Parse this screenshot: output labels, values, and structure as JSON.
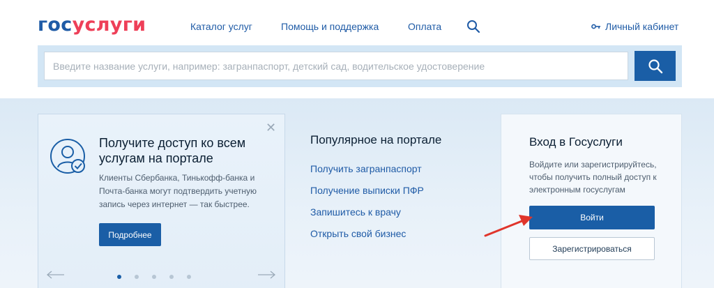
{
  "header": {
    "logo_part1": "гос",
    "logo_part2": "услуги",
    "nav": [
      {
        "label": "Каталог услуг"
      },
      {
        "label": "Помощь и поддержка"
      },
      {
        "label": "Оплата"
      }
    ],
    "cabinet_label": "Личный кабинет"
  },
  "search": {
    "placeholder": "Введите название услуги, например: загранпаспорт, детский сад, водительское удостоверение"
  },
  "promo": {
    "title": "Получите доступ ко всем услугам на портале",
    "text": "Клиенты Сбербанка, Тинькофф-банка и Почта-банка могут подтвердить учетную запись через интернет — так быстрее.",
    "button_label": "Подробнее",
    "close_glyph": "✕",
    "slides_count": 5,
    "active_slide": 1
  },
  "popular": {
    "title": "Популярное на портале",
    "links": [
      {
        "label": "Получить загранпаспорт"
      },
      {
        "label": "Получение выписки ПФР"
      },
      {
        "label": "Запишитесь к врачу"
      },
      {
        "label": "Открыть свой бизнес"
      }
    ]
  },
  "login": {
    "title": "Вход в Госуслуги",
    "text": "Войдите или зарегистрируйтесь, чтобы получить полный доступ к электронным госуслугам",
    "login_label": "Войти",
    "register_label": "Зарегистрироваться"
  },
  "colors": {
    "brand_blue": "#1a5ea6",
    "brand_red": "#ee3f58",
    "annotation_arrow": "#e0352b"
  }
}
